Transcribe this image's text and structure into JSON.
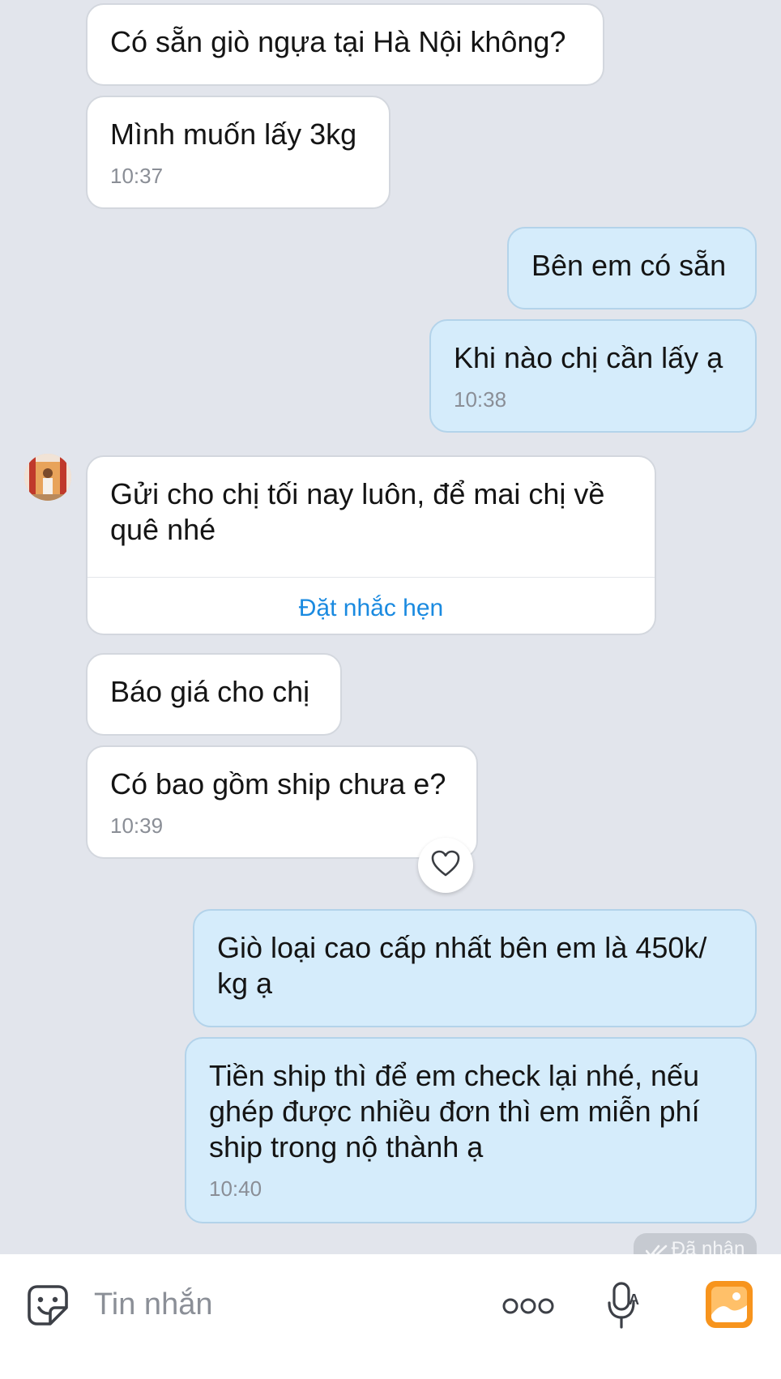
{
  "messages": [
    {
      "text": "Có sẵn giò ngựa tại Hà Nội không?"
    },
    {
      "text": "Mình muốn lấy 3kg",
      "time": "10:37"
    },
    {
      "text": "Bên em có sẵn"
    },
    {
      "text": "Khi nào chị cần lấy ạ",
      "time": "10:38"
    },
    {
      "text": "Gửi cho chị tối nay luôn, để mai chị về quê nhé",
      "action": "Đặt nhắc hẹn"
    },
    {
      "text": "Báo giá cho chị"
    },
    {
      "text": "Có bao gồm ship chưa e?",
      "time": "10:39"
    },
    {
      "text": "Giò loại cao cấp nhất bên em là 450k/ kg ạ"
    },
    {
      "text": "Tiền ship thì để em check lại nhé, nếu ghép được nhiều đơn thì em miễn phí ship trong nộ thành ạ",
      "time": "10:40"
    }
  ],
  "status": {
    "received": "Đã nhận"
  },
  "composer": {
    "placeholder": "Tin nhắn"
  },
  "colors": {
    "background": "#e2e5ec",
    "incoming_bubble": "#ffffff",
    "outgoing_bubble": "#d5ecfb",
    "link": "#1a8ae0",
    "gallery_icon": "#f7941d"
  },
  "icons": [
    "sticker-icon",
    "heart-icon",
    "more-icon",
    "voice-icon",
    "gallery-icon",
    "double-check-icon"
  ]
}
